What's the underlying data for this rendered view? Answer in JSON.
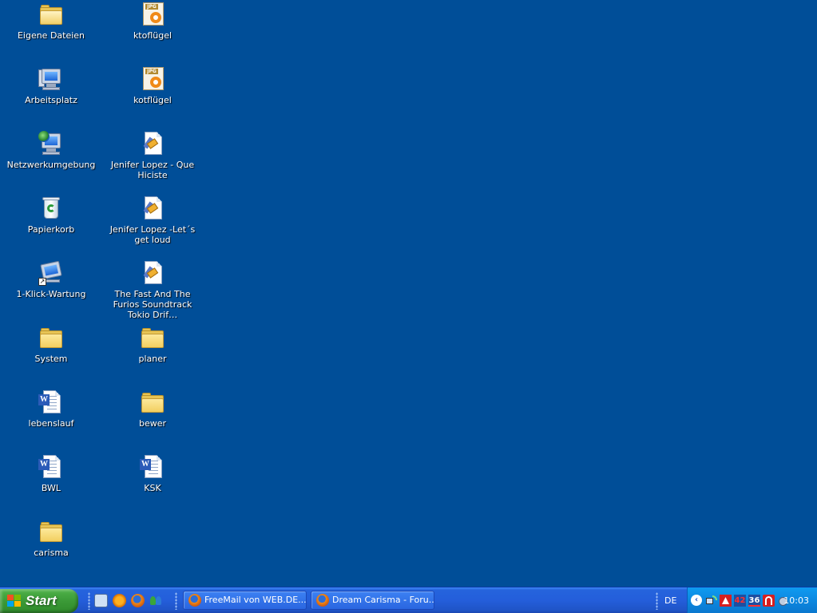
{
  "desktop": {
    "icons": [
      {
        "label": "Eigene Dateien",
        "icon": "my-documents-icon"
      },
      {
        "label": "Arbeitsplatz",
        "icon": "my-computer-icon"
      },
      {
        "label": "Netzwerkumgebung",
        "icon": "network-places-icon"
      },
      {
        "label": "Papierkorb",
        "icon": "recycle-bin-icon"
      },
      {
        "label": "1-Klick-Wartung",
        "icon": "maintenance-shortcut-icon"
      },
      {
        "label": "System",
        "icon": "folder-icon"
      },
      {
        "label": "lebenslauf",
        "icon": "word-document-icon"
      },
      {
        "label": "BWL",
        "icon": "word-document-icon"
      },
      {
        "label": "carisma",
        "icon": "folder-icon"
      },
      {
        "label": "ktoflügel",
        "icon": "jpg-image-icon"
      },
      {
        "label": "kotflügel",
        "icon": "jpg-image-icon"
      },
      {
        "label": "Jenifer Lopez - Que Hiciste",
        "icon": "media-file-icon"
      },
      {
        "label": "Jenifer Lopez -Let´s get loud",
        "icon": "media-file-icon"
      },
      {
        "label": "The Fast And The Furios Soundtrack Tokio Drif…",
        "icon": "media-file-icon"
      },
      {
        "label": "planer",
        "icon": "folder-icon"
      },
      {
        "label": "bewer",
        "icon": "folder-icon"
      },
      {
        "label": "KSK",
        "icon": "word-document-icon"
      }
    ],
    "jpg_badge": "JPG",
    "word_letter": "W",
    "shortcut_arrow": "↗"
  },
  "taskbar": {
    "start_label": "Start",
    "quick_launch": [
      "show-desktop-icon",
      "media-player-icon",
      "firefox-icon",
      "messenger-icon"
    ],
    "tasks": [
      {
        "label": "FreeMail von WEB.DE...",
        "icon": "firefox-icon"
      },
      {
        "label": "Dream Carisma - Foru...",
        "icon": "firefox-icon"
      }
    ],
    "language": "DE",
    "tray_chevron": "‹",
    "tray_icons": [
      "network-icon",
      "antivirus-icon",
      "tray-icon-42",
      "tray-icon-36",
      "avira-icon",
      "speaker-icon"
    ],
    "tray_numbers": [
      "42",
      "36"
    ],
    "clock": "10:03"
  },
  "colors": {
    "desktop_bg": "#004e98",
    "taskbar_blue": "#245edb",
    "start_green": "#3b9a37",
    "tray_blue": "#0c88e0"
  }
}
